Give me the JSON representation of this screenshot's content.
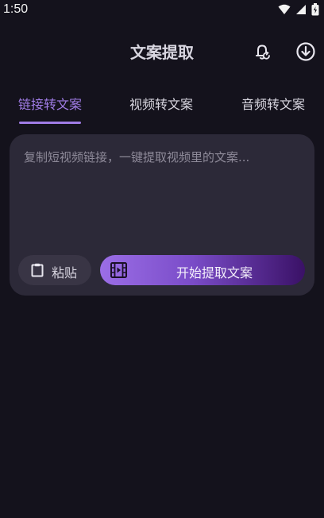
{
  "status_bar": {
    "time": "1:50"
  },
  "header": {
    "title": "文案提取"
  },
  "tabs": [
    {
      "label": "链接转文案",
      "active": true
    },
    {
      "label": "视频转文案",
      "active": false
    },
    {
      "label": "音频转文案",
      "active": false
    }
  ],
  "input": {
    "placeholder": "复制短视频链接，一键提取视频里的文案..."
  },
  "actions": {
    "paste_label": "粘贴",
    "start_label": "开始提取文案"
  },
  "colors": {
    "accent": "#a07ce6",
    "background": "#14121c",
    "card": "#2c2938"
  },
  "icons": [
    "wifi-icon",
    "cell-signal-icon",
    "battery-icon",
    "bell-refresh-icon",
    "download-icon",
    "clipboard-icon",
    "film-icon"
  ]
}
